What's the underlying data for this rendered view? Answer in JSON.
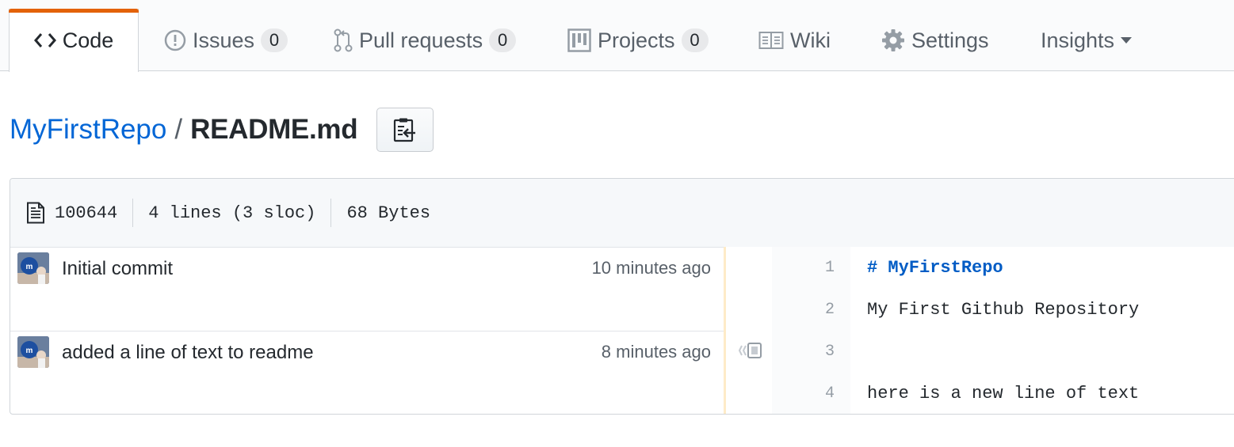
{
  "tabs": [
    {
      "label": "Code",
      "icon": "code-icon",
      "selected": true
    },
    {
      "label": "Issues",
      "count": "0",
      "icon": "issue-opened-icon"
    },
    {
      "label": "Pull requests",
      "count": "0",
      "icon": "git-pull-request-icon"
    },
    {
      "label": "Projects",
      "count": "0",
      "icon": "project-icon"
    },
    {
      "label": "Wiki",
      "icon": "book-icon"
    },
    {
      "label": "Settings",
      "icon": "gear-icon"
    },
    {
      "label": "Insights",
      "icon": "triangle-down-icon"
    }
  ],
  "breadcrumb": {
    "repo": "MyFirstRepo",
    "separator": "/",
    "file": "README.md"
  },
  "file_info": {
    "mode": "100644",
    "lines": "4 lines (3 sloc)",
    "size": "68 Bytes"
  },
  "blame": [
    {
      "message": "Initial commit",
      "time": "10 minutes ago",
      "lines": [
        {
          "number": "1",
          "text": "# MyFirstRepo"
        },
        {
          "number": "2",
          "text": "My First Github Repository"
        }
      ]
    },
    {
      "message": "added a line of text to readme",
      "time": "8 minutes ago",
      "lines": [
        {
          "number": "3",
          "text": ""
        },
        {
          "number": "4",
          "text": "here is a new line of text"
        }
      ]
    }
  ],
  "colors": {
    "accent_tab": "#e36209",
    "link": "#0366d6",
    "heading_code": "#005cc5",
    "age_bar": "#feebc8"
  }
}
